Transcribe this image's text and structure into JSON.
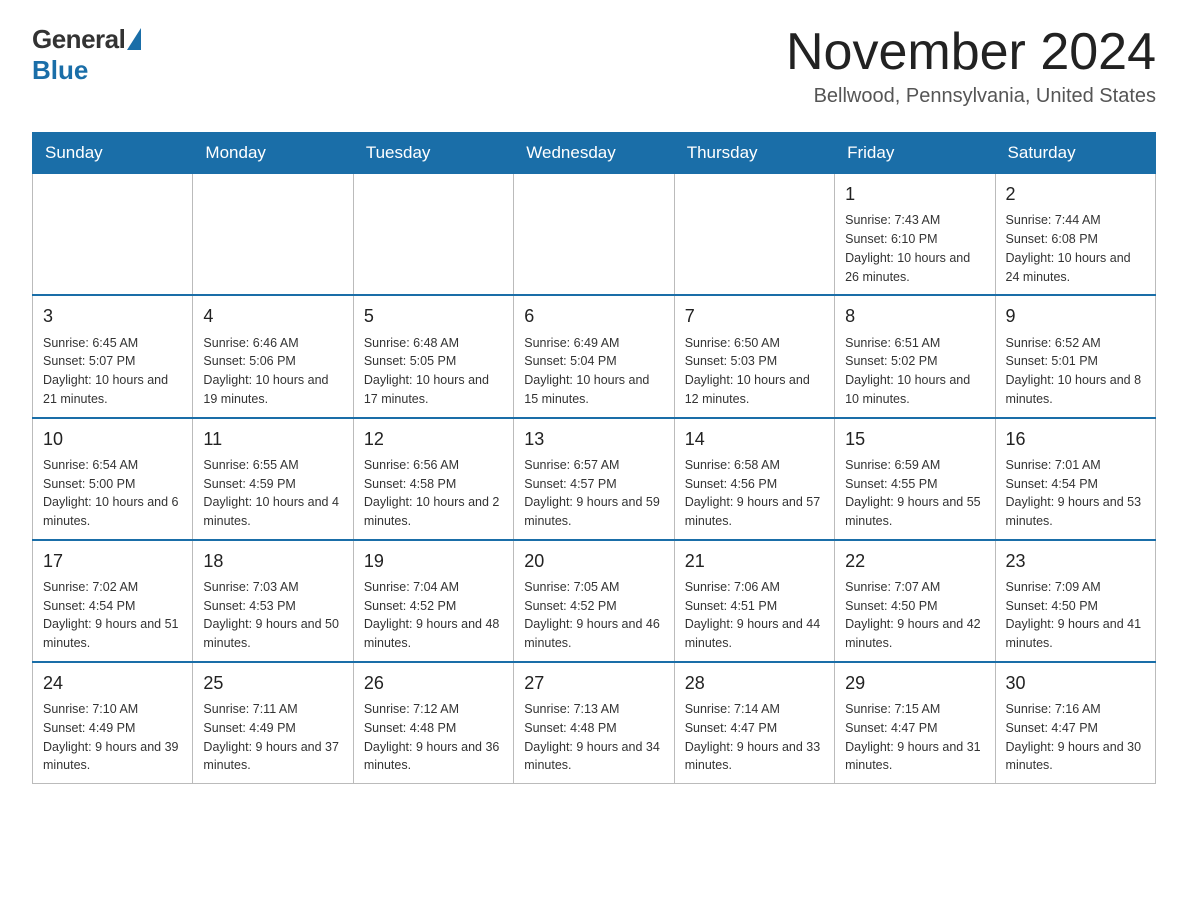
{
  "header": {
    "logo": {
      "general_text": "General",
      "blue_text": "Blue"
    },
    "title": "November 2024",
    "location": "Bellwood, Pennsylvania, United States"
  },
  "calendar": {
    "days_of_week": [
      "Sunday",
      "Monday",
      "Tuesday",
      "Wednesday",
      "Thursday",
      "Friday",
      "Saturday"
    ],
    "weeks": [
      [
        {
          "day": "",
          "info": ""
        },
        {
          "day": "",
          "info": ""
        },
        {
          "day": "",
          "info": ""
        },
        {
          "day": "",
          "info": ""
        },
        {
          "day": "",
          "info": ""
        },
        {
          "day": "1",
          "info": "Sunrise: 7:43 AM\nSunset: 6:10 PM\nDaylight: 10 hours and 26 minutes."
        },
        {
          "day": "2",
          "info": "Sunrise: 7:44 AM\nSunset: 6:08 PM\nDaylight: 10 hours and 24 minutes."
        }
      ],
      [
        {
          "day": "3",
          "info": "Sunrise: 6:45 AM\nSunset: 5:07 PM\nDaylight: 10 hours and 21 minutes."
        },
        {
          "day": "4",
          "info": "Sunrise: 6:46 AM\nSunset: 5:06 PM\nDaylight: 10 hours and 19 minutes."
        },
        {
          "day": "5",
          "info": "Sunrise: 6:48 AM\nSunset: 5:05 PM\nDaylight: 10 hours and 17 minutes."
        },
        {
          "day": "6",
          "info": "Sunrise: 6:49 AM\nSunset: 5:04 PM\nDaylight: 10 hours and 15 minutes."
        },
        {
          "day": "7",
          "info": "Sunrise: 6:50 AM\nSunset: 5:03 PM\nDaylight: 10 hours and 12 minutes."
        },
        {
          "day": "8",
          "info": "Sunrise: 6:51 AM\nSunset: 5:02 PM\nDaylight: 10 hours and 10 minutes."
        },
        {
          "day": "9",
          "info": "Sunrise: 6:52 AM\nSunset: 5:01 PM\nDaylight: 10 hours and 8 minutes."
        }
      ],
      [
        {
          "day": "10",
          "info": "Sunrise: 6:54 AM\nSunset: 5:00 PM\nDaylight: 10 hours and 6 minutes."
        },
        {
          "day": "11",
          "info": "Sunrise: 6:55 AM\nSunset: 4:59 PM\nDaylight: 10 hours and 4 minutes."
        },
        {
          "day": "12",
          "info": "Sunrise: 6:56 AM\nSunset: 4:58 PM\nDaylight: 10 hours and 2 minutes."
        },
        {
          "day": "13",
          "info": "Sunrise: 6:57 AM\nSunset: 4:57 PM\nDaylight: 9 hours and 59 minutes."
        },
        {
          "day": "14",
          "info": "Sunrise: 6:58 AM\nSunset: 4:56 PM\nDaylight: 9 hours and 57 minutes."
        },
        {
          "day": "15",
          "info": "Sunrise: 6:59 AM\nSunset: 4:55 PM\nDaylight: 9 hours and 55 minutes."
        },
        {
          "day": "16",
          "info": "Sunrise: 7:01 AM\nSunset: 4:54 PM\nDaylight: 9 hours and 53 minutes."
        }
      ],
      [
        {
          "day": "17",
          "info": "Sunrise: 7:02 AM\nSunset: 4:54 PM\nDaylight: 9 hours and 51 minutes."
        },
        {
          "day": "18",
          "info": "Sunrise: 7:03 AM\nSunset: 4:53 PM\nDaylight: 9 hours and 50 minutes."
        },
        {
          "day": "19",
          "info": "Sunrise: 7:04 AM\nSunset: 4:52 PM\nDaylight: 9 hours and 48 minutes."
        },
        {
          "day": "20",
          "info": "Sunrise: 7:05 AM\nSunset: 4:52 PM\nDaylight: 9 hours and 46 minutes."
        },
        {
          "day": "21",
          "info": "Sunrise: 7:06 AM\nSunset: 4:51 PM\nDaylight: 9 hours and 44 minutes."
        },
        {
          "day": "22",
          "info": "Sunrise: 7:07 AM\nSunset: 4:50 PM\nDaylight: 9 hours and 42 minutes."
        },
        {
          "day": "23",
          "info": "Sunrise: 7:09 AM\nSunset: 4:50 PM\nDaylight: 9 hours and 41 minutes."
        }
      ],
      [
        {
          "day": "24",
          "info": "Sunrise: 7:10 AM\nSunset: 4:49 PM\nDaylight: 9 hours and 39 minutes."
        },
        {
          "day": "25",
          "info": "Sunrise: 7:11 AM\nSunset: 4:49 PM\nDaylight: 9 hours and 37 minutes."
        },
        {
          "day": "26",
          "info": "Sunrise: 7:12 AM\nSunset: 4:48 PM\nDaylight: 9 hours and 36 minutes."
        },
        {
          "day": "27",
          "info": "Sunrise: 7:13 AM\nSunset: 4:48 PM\nDaylight: 9 hours and 34 minutes."
        },
        {
          "day": "28",
          "info": "Sunrise: 7:14 AM\nSunset: 4:47 PM\nDaylight: 9 hours and 33 minutes."
        },
        {
          "day": "29",
          "info": "Sunrise: 7:15 AM\nSunset: 4:47 PM\nDaylight: 9 hours and 31 minutes."
        },
        {
          "day": "30",
          "info": "Sunrise: 7:16 AM\nSunset: 4:47 PM\nDaylight: 9 hours and 30 minutes."
        }
      ]
    ]
  }
}
